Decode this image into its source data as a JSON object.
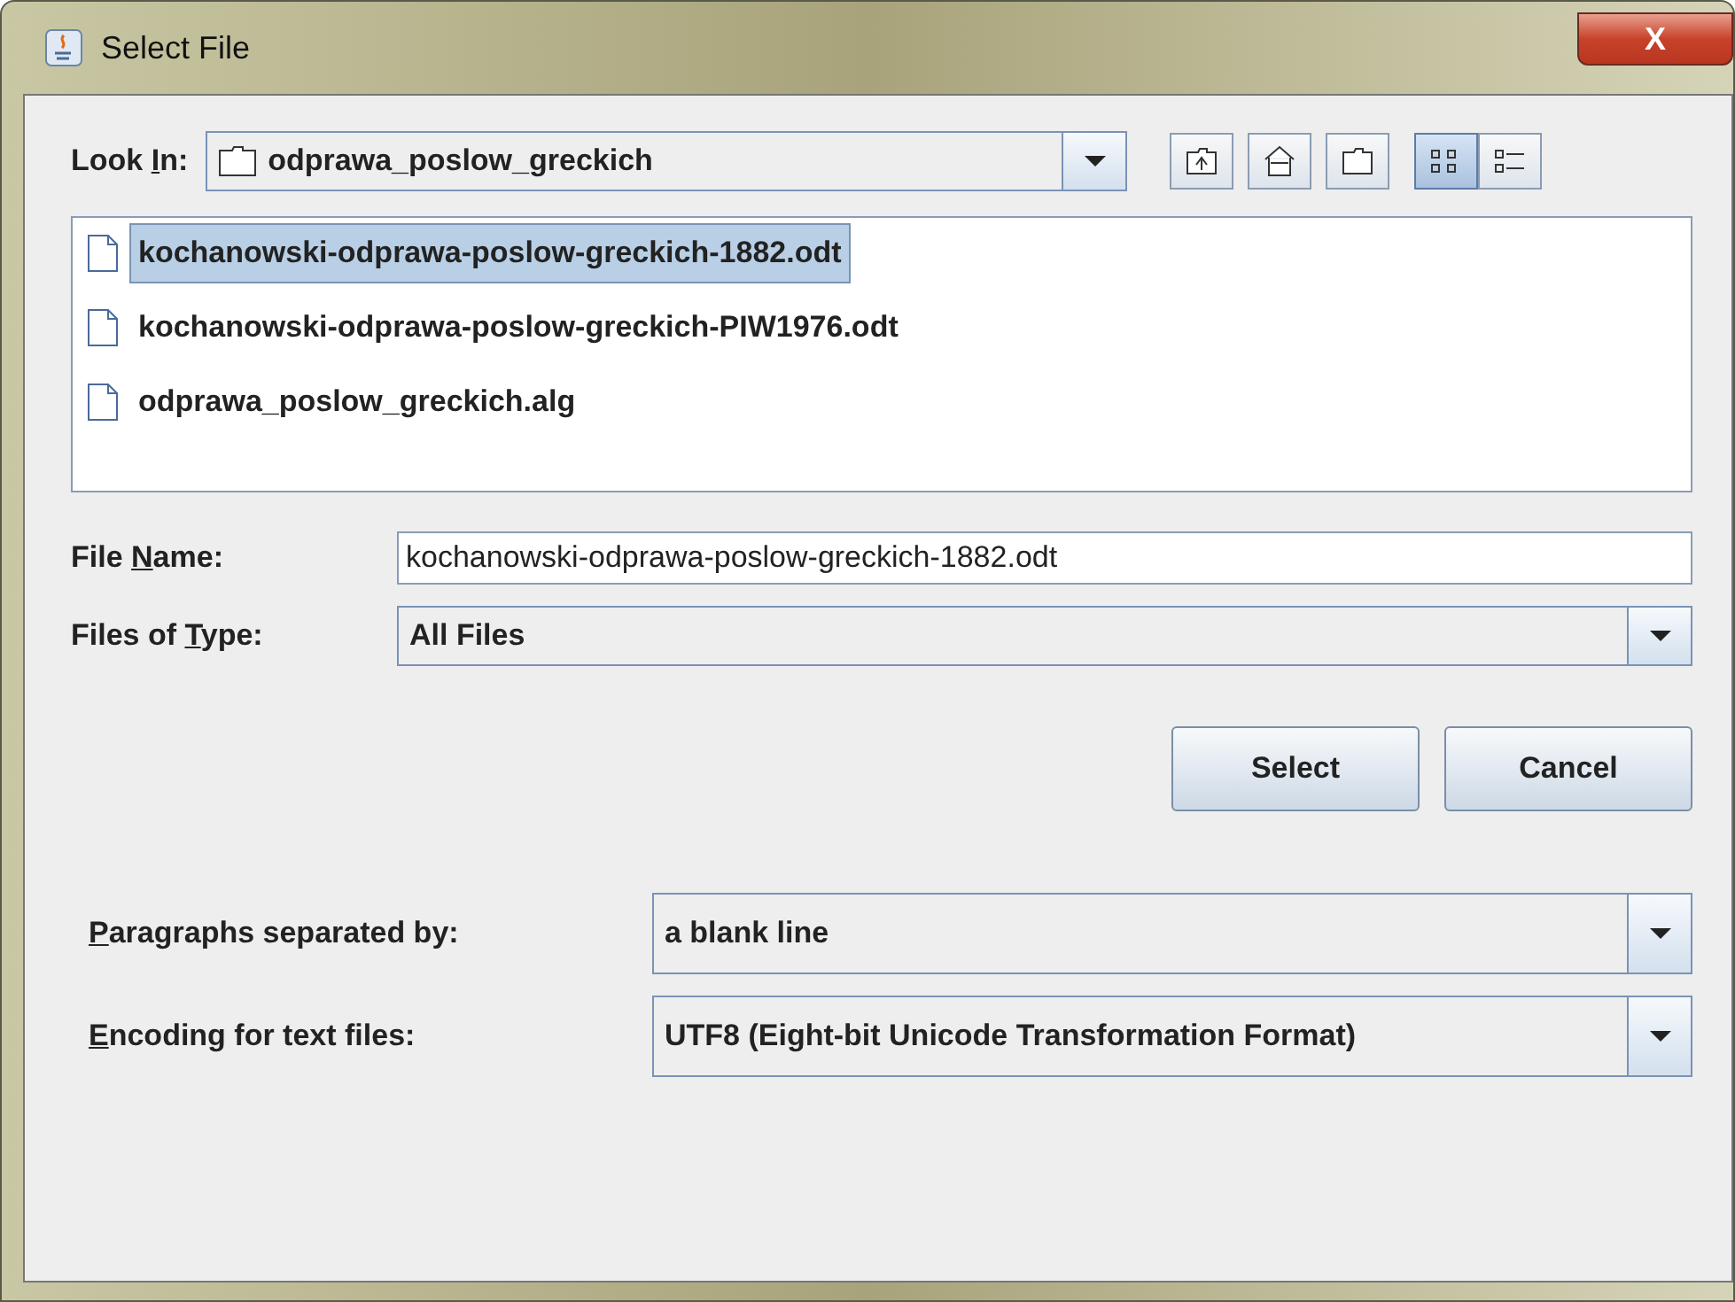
{
  "window": {
    "title": "Select File",
    "close": "X"
  },
  "look_in": {
    "label": {
      "pre": "Look ",
      "key": "I",
      "post": "n:"
    },
    "value": "odprawa_poslow_greckich"
  },
  "toolbar": [
    {
      "kind": "up",
      "selected": false
    },
    {
      "kind": "home",
      "selected": false
    },
    {
      "kind": "new-folder",
      "selected": false
    },
    {
      "kind": "list",
      "selected": true
    },
    {
      "kind": "details",
      "selected": false
    }
  ],
  "files": [
    {
      "name": "kochanowski-odprawa-poslow-greckich-1882.odt",
      "selected": true
    },
    {
      "name": "kochanowski-odprawa-poslow-greckich-PIW1976.odt",
      "selected": false
    },
    {
      "name": "odprawa_poslow_greckich.alg",
      "selected": false
    }
  ],
  "file_name": {
    "label": {
      "pre": "File ",
      "key": "N",
      "post": "ame:"
    },
    "value": "kochanowski-odprawa-poslow-greckich-1882.odt"
  },
  "file_type": {
    "label": {
      "pre": "Files of ",
      "key": "T",
      "post": "ype:"
    },
    "value": "All Files"
  },
  "buttons": [
    "Select",
    "Cancel"
  ],
  "options": [
    {
      "label": {
        "key": "P",
        "post": "aragraphs separated by:"
      },
      "value": "a blank line"
    },
    {
      "label": {
        "key": "E",
        "post": "ncoding for text files:"
      },
      "value": "UTF8 (Eight-bit Unicode Transformation Format)"
    }
  ]
}
